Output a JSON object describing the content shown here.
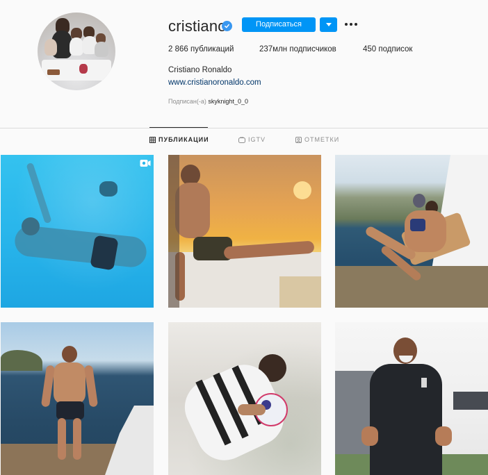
{
  "profile": {
    "username": "cristiano",
    "verified": true,
    "follow_label": "Подписаться",
    "stats": {
      "posts": "2 866 публикаций",
      "followers": "237млн подписчиков",
      "following": "450 подписок"
    },
    "full_name": "Cristiano Ronaldo",
    "website": "www.cristianoronaldo.com",
    "followed_by_prefix": "Подписан(-а)",
    "followed_by_user": "skyknight_0_0"
  },
  "tabs": [
    {
      "label": "ПУБЛИКАЦИИ",
      "icon": "grid-icon",
      "active": true
    },
    {
      "label": "IGTV",
      "icon": "igtv-icon",
      "active": false
    },
    {
      "label": "ОТМЕТКИ",
      "icon": "tagged-icon",
      "active": false
    }
  ],
  "posts": [
    {
      "icon": "video-icon"
    },
    {},
    {},
    {},
    {},
    {}
  ],
  "colors": {
    "accent": "#0095f6",
    "verified": "#3897f0",
    "link": "#003569",
    "background": "#fafafa",
    "divider": "#dbdbdb"
  }
}
